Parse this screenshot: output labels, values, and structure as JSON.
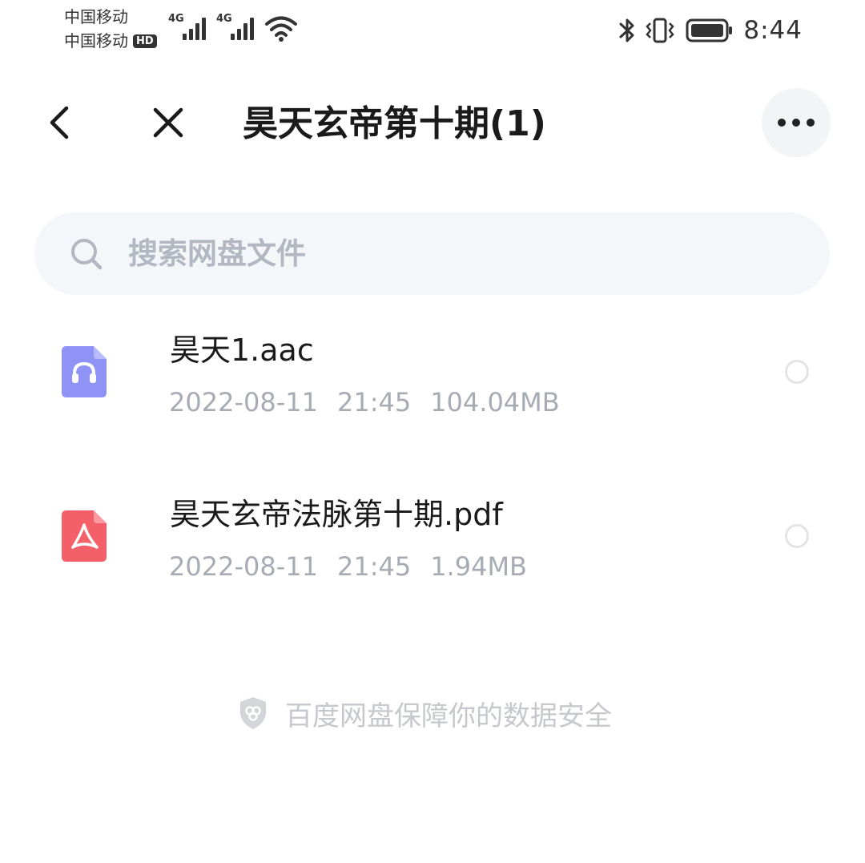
{
  "status_bar": {
    "carrier_1": "中国移动",
    "carrier_2": "中国移动",
    "hd_badge": "HD",
    "network_1": "4G",
    "network_2": "4G",
    "time": "8:44",
    "icons": [
      "signal-icon",
      "wifi-icon",
      "bluetooth-icon",
      "vibrate-icon",
      "battery-icon"
    ]
  },
  "header": {
    "title": "昊天玄帝第十期(1)",
    "icons": [
      "back-arrow-icon",
      "close-icon",
      "more-dots-icon"
    ]
  },
  "search": {
    "placeholder": "搜索网盘文件",
    "icon": "search-icon"
  },
  "files": [
    {
      "name": "昊天1.aac",
      "date": "2022-08-11",
      "time": "21:45",
      "size": "104.04MB",
      "icon": "audio-file-icon",
      "icon_color": "#8f93f5"
    },
    {
      "name": "昊天玄帝法脉第十期.pdf",
      "date": "2022-08-11",
      "time": "21:45",
      "size": "1.94MB",
      "icon": "pdf-file-icon",
      "icon_color": "#f4606a"
    }
  ],
  "footer": {
    "text": "百度网盘保障你的数据安全",
    "icon": "shield-icon"
  },
  "colors": {
    "title": "#1a1a1a",
    "meta": "#a7abb4",
    "search_bg": "#f5f6fa",
    "placeholder": "#b2b7c2"
  }
}
